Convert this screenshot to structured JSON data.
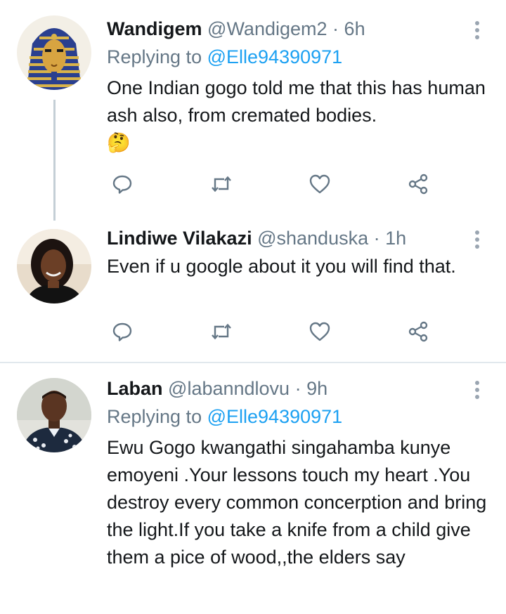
{
  "tweets": [
    {
      "name": "Wandigem",
      "handle": "@Wandigem2",
      "dot": "·",
      "time": "6h",
      "replying_prefix": "Replying to",
      "replying_to": "@Elle94390971",
      "text": "One Indian gogo told me that this has human ash also, from cremated bodies.",
      "emoji": "🤔"
    },
    {
      "name": "Lindiwe Vilakazi",
      "handle": "@shanduska",
      "dot": "·",
      "time": "1h",
      "text": "Even if u google about it you will find that."
    },
    {
      "name": "Laban",
      "handle": "@labanndlovu",
      "dot": "·",
      "time": "9h",
      "replying_prefix": "Replying to",
      "replying_to": "@Elle94390971",
      "text": "Ewu Gogo kwangathi singahamba kunye emoyeni .Your lessons touch my heart .You destroy every common concerption and bring the light.If you take a knife from a child give them a pice of wood,,the elders say"
    }
  ],
  "icons": {
    "reply": "reply-icon",
    "retweet": "retweet-icon",
    "like": "heart-icon",
    "share": "share-icon",
    "more": "more-vertical-icon"
  },
  "colors": {
    "link": "#1da1f2",
    "secondary": "#657786",
    "icon": "#657786",
    "divider": "#e1e8ed"
  }
}
